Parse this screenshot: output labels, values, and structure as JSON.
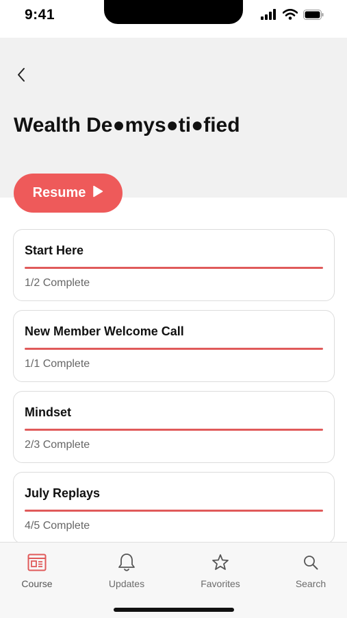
{
  "status_bar": {
    "time": "9:41"
  },
  "header": {
    "title": "Wealth De●mys●ti●fied"
  },
  "resume_button": {
    "label": "Resume"
  },
  "colors": {
    "accent": "#ee5a5a",
    "header_bg": "#f1f1f1",
    "tab_bar_bg": "#f7f7f7"
  },
  "sections": [
    {
      "title": "Start Here",
      "status": "1/2 Complete",
      "progress": 1.0
    },
    {
      "title": "New Member Welcome Call",
      "status": "1/1 Complete",
      "progress": 1.0
    },
    {
      "title": "Mindset",
      "status": "2/3 Complete",
      "progress": 1.0
    },
    {
      "title": "July Replays",
      "status": "4/5 Complete",
      "progress": 1.0
    }
  ],
  "tab_bar": {
    "tabs": [
      {
        "label": "Course",
        "icon": "course-icon",
        "active": true
      },
      {
        "label": "Updates",
        "icon": "bell-icon",
        "active": false
      },
      {
        "label": "Favorites",
        "icon": "star-icon",
        "active": false
      },
      {
        "label": "Search",
        "icon": "search-icon",
        "active": false
      }
    ]
  }
}
